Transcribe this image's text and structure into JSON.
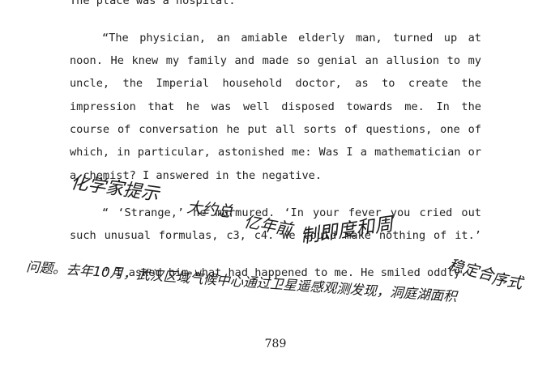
{
  "document": {
    "lines": [
      "The place was a hospital.",
      "“The physician, an amiable elderly man, turned up at",
      "noon. He knew my family and made so genial an allusion to my",
      "uncle, the Imperial household doctor, as to create the",
      "impression that he was well disposed towards me. In the",
      "course of conversation he put all sorts of questions, one of",
      "which, in particular, astonished me: Was I a mathematician or",
      "a chemist? I answered in the negative.",
      "“ ‘Strange,’ he murmured. ‘In your fever you cried out",
      "such unusual formulas, c3, c4. We could make nothing of it.’",
      "“ I asked him what had happened to me. He smiled oddly."
    ],
    "page_number": "789"
  },
  "handwriting": {
    "note_1": "化学家提示",
    "note_2": "大约总",
    "note_3": "亿年前",
    "note_4": "制即度和周",
    "note_5": "稳定合",
    "note_6": "序式",
    "note_7": "问题。去年10月，武汉区域气候中心通过卫星遥感观测发现，洞庭湖面积"
  }
}
